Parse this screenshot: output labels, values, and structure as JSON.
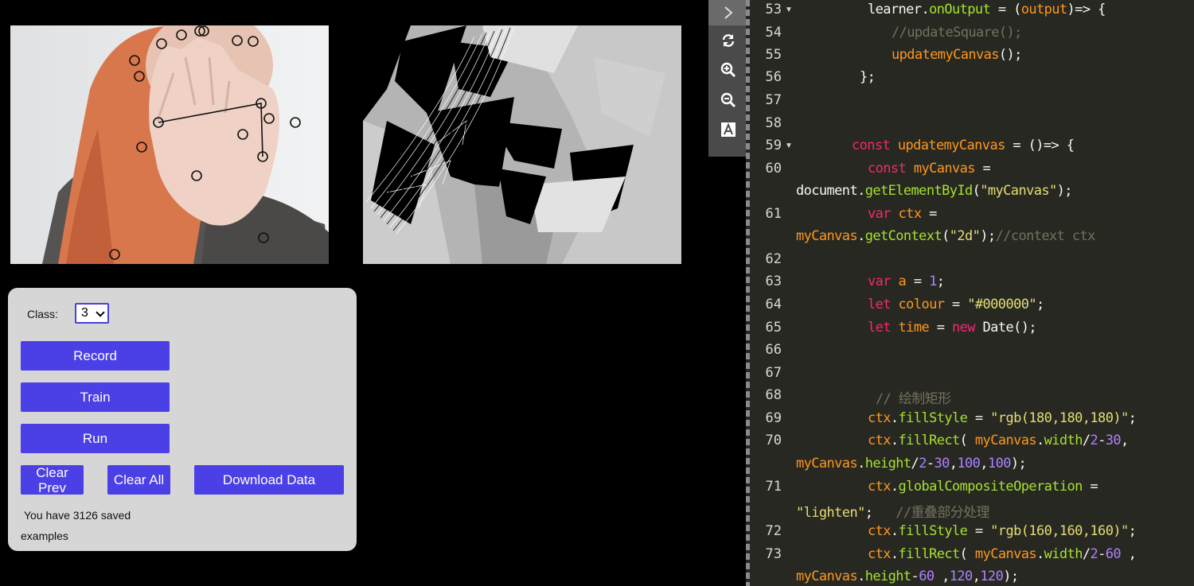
{
  "panel": {
    "class_label": "Class:",
    "class_value": "3",
    "record_label": "Record",
    "train_label": "Train",
    "run_label": "Run",
    "clear_prev_label": "Clear Prev",
    "clear_all_label": "Clear All",
    "download_label": "Download Data",
    "saved_line1": "You have 3126 saved",
    "saved_line2": "examples"
  },
  "toolbar": {
    "icons": [
      "chevron-right-icon",
      "refresh-icon",
      "zoom-in-icon",
      "zoom-out-icon",
      "font-size-icon"
    ]
  },
  "editor": {
    "lines": [
      {
        "num": "53",
        "fold": true
      },
      {
        "num": "54"
      },
      {
        "num": "55"
      },
      {
        "num": "56"
      },
      {
        "num": "57"
      },
      {
        "num": "58"
      },
      {
        "num": "59",
        "fold": true
      },
      {
        "num": "60"
      },
      {
        "num": "61"
      },
      {
        "num": "62"
      },
      {
        "num": "63"
      },
      {
        "num": "64"
      },
      {
        "num": "65"
      },
      {
        "num": "66"
      },
      {
        "num": "67"
      },
      {
        "num": "68"
      },
      {
        "num": "69"
      },
      {
        "num": "70"
      },
      {
        "num": "71"
      },
      {
        "num": "72"
      },
      {
        "num": "73"
      }
    ],
    "code": [
      "learner.onOutput = (output)=> {",
      "//updateSquare();",
      "updatemyCanvas();",
      "};",
      "const updatemyCanvas = ()=> {",
      "const myCanvas =",
      "document.getElementById(\"myCanvas\");",
      "var ctx =",
      "myCanvas.getContext(\"2d\");//context ctx",
      "var a = 1;",
      "let colour = \"#000000\";",
      "let time = new Date();",
      "// 绘制矩形",
      "ctx.fillStyle = \"rgb(180,180,180)\";",
      "ctx.fillRect( myCanvas.width/2-30,",
      "myCanvas.height/2-30,100,100);",
      "ctx.globalCompositeOperation =",
      "\"lighten\";   //重叠部分处理",
      "ctx.fillStyle = \"rgb(160,160,160)\";",
      "ctx.fillRect( myCanvas.width/2-60 ,",
      "myCanvas.height-60 ,120,120);"
    ]
  }
}
